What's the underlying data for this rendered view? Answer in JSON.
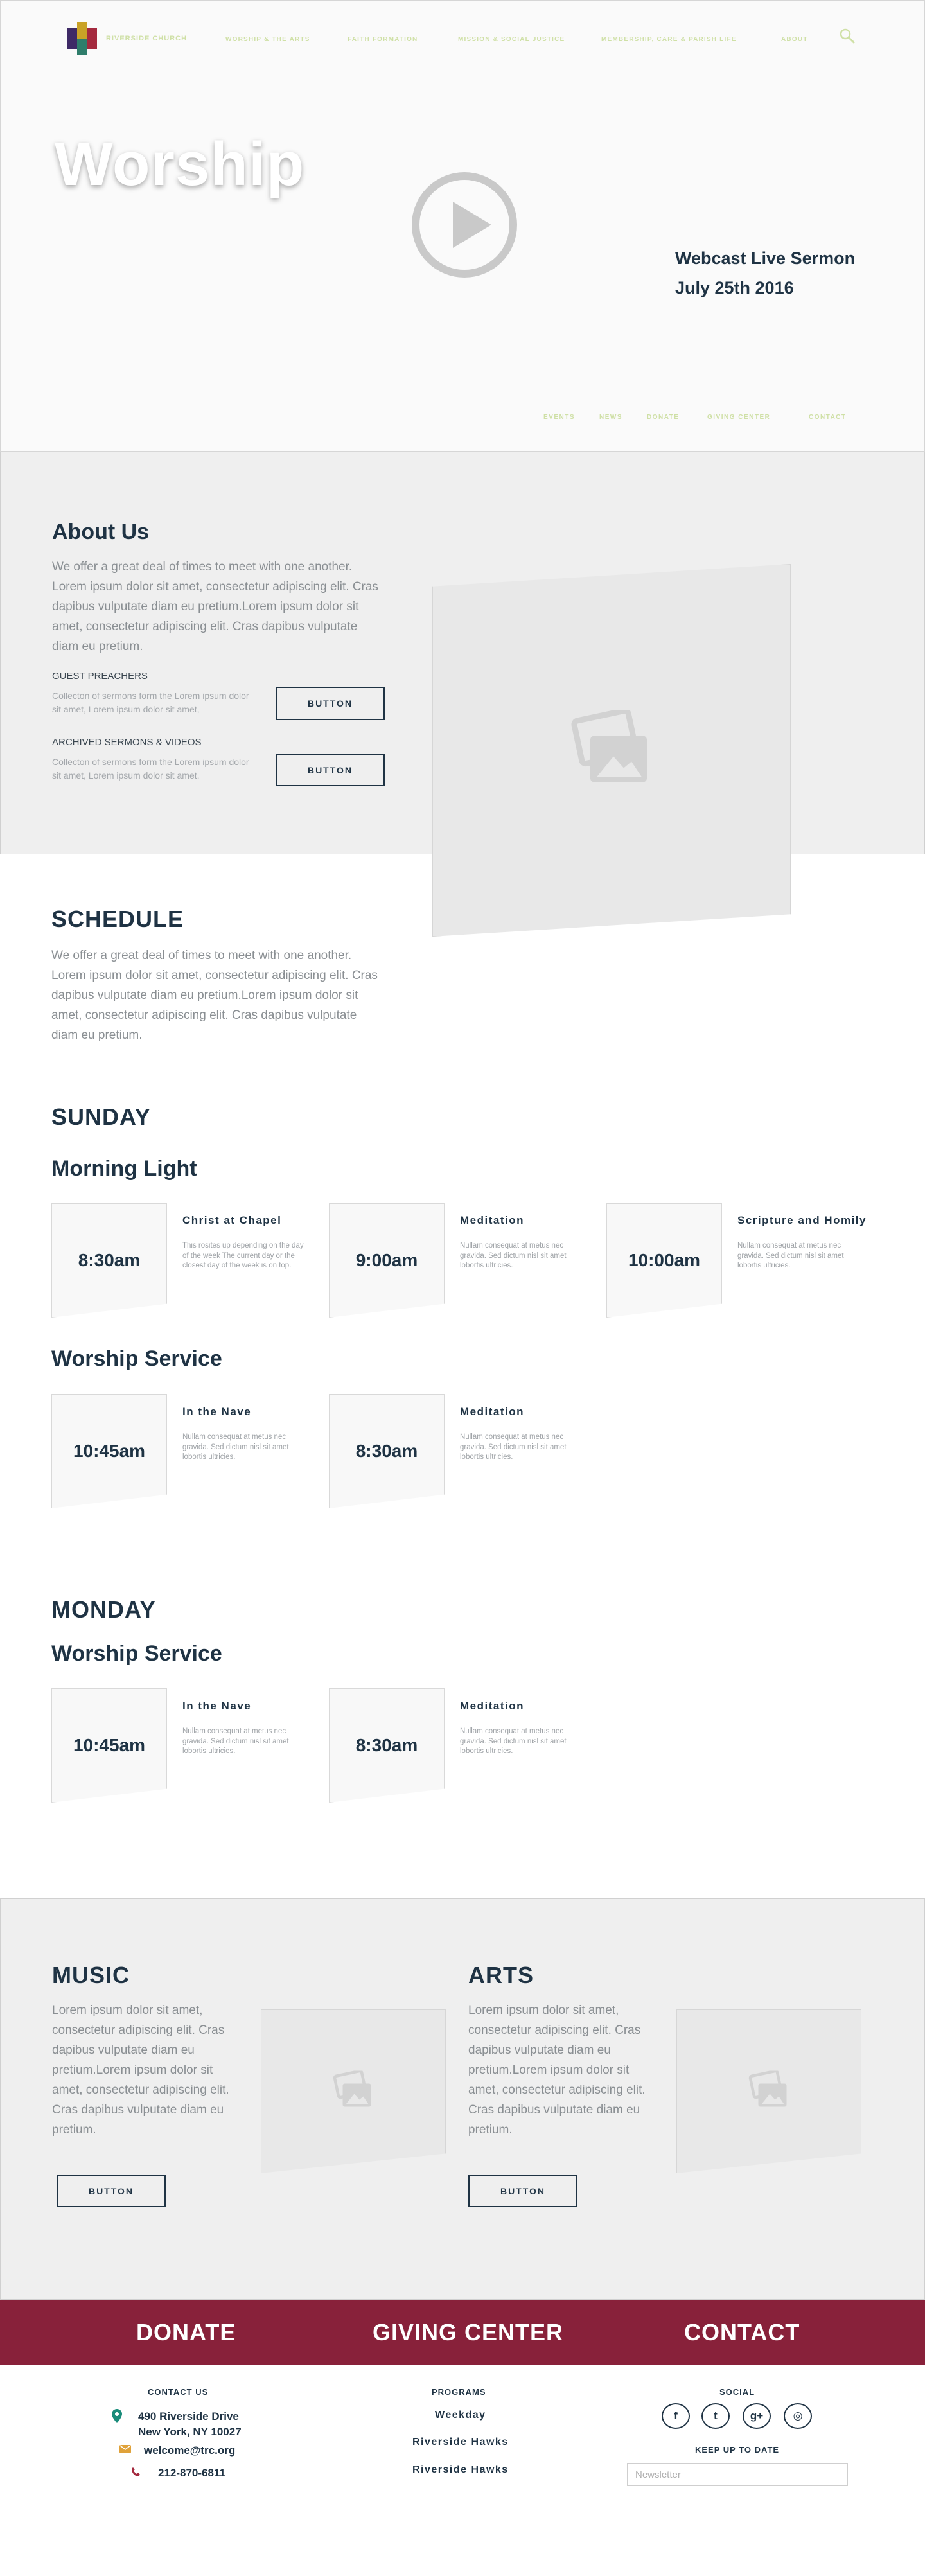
{
  "nav": {
    "logo_text": "RIVERSIDE CHURCH",
    "items": [
      "WORSHIP & THE ARTS",
      "FAITH FORMATION",
      "MISSION & SOCIAL JUSTICE",
      "MEMBERSHIP, CARE & PARISH LIFE",
      "ABOUT"
    ]
  },
  "hero": {
    "title": "Worship",
    "webcast_line1": "Webcast Live Sermon",
    "webcast_line2": "July 25th 2016"
  },
  "subnav": [
    "EVENTS",
    "NEWS",
    "DONATE",
    "GIVING CENTER",
    "CONTACT"
  ],
  "about": {
    "heading": "About Us",
    "body": "We offer a great deal of times to meet with one another. Lorem ipsum dolor sit amet, consectetur adipiscing elit. Cras dapibus vulputate diam eu pretium.Lorem ipsum dolor sit amet, consectetur adipiscing elit. Cras dapibus vulputate diam eu pretium.",
    "guest_label": "GUEST PREACHERS",
    "guest_text": "Collecton of sermons form the Lorem ipsum dolor sit amet,  Lorem ipsum dolor sit amet,",
    "archived_label": "ARCHIVED SERMONS & VIDEOS",
    "archived_text": "Collecton of sermons form the Lorem ipsum dolor sit amet,  Lorem ipsum dolor sit amet,",
    "button_label": "BUTTON"
  },
  "schedule": {
    "heading": "SCHEDULE",
    "body": "We offer a great deal of times to meet with one another. Lorem ipsum dolor sit amet, consectetur adipiscing elit. Cras dapibus vulputate diam eu pretium.Lorem ipsum dolor sit amet, consectetur adipiscing elit. Cras dapibus vulputate diam eu pretium.",
    "sunday": {
      "day": "SUNDAY",
      "morning_heading": "Morning Light",
      "morning": [
        {
          "time": "8:30am",
          "title": "Christ at Chapel",
          "desc": "This rosites up depending on the day of the week The current day or the closest day of the week is on top."
        },
        {
          "time": "9:00am",
          "title": "Meditation",
          "desc": "Nullam consequat at metus nec gravida. Sed dictum nisl sit amet lobortis ultricies."
        },
        {
          "time": "10:00am",
          "title": "Scripture and Homily",
          "desc": "Nullam consequat at metus nec gravida. Sed dictum nisl sit amet lobortis ultricies."
        }
      ],
      "service_heading": "Worship Service",
      "service": [
        {
          "time": "10:45am",
          "title": "In the Nave",
          "desc": "Nullam consequat at metus nec gravida. Sed dictum nisl sit amet lobortis ultricies."
        },
        {
          "time": "8:30am",
          "title": "Meditation",
          "desc": "Nullam consequat at metus nec gravida. Sed dictum nisl sit amet lobortis ultricies."
        }
      ]
    },
    "monday": {
      "day": "MONDAY",
      "service_heading": "Worship Service",
      "service": [
        {
          "time": "10:45am",
          "title": "In the Nave",
          "desc": "Nullam consequat at metus nec gravida. Sed dictum nisl sit amet lobortis ultricies."
        },
        {
          "time": "8:30am",
          "title": "Meditation",
          "desc": "Nullam consequat at metus nec gravida. Sed dictum nisl sit amet lobortis ultricies."
        }
      ]
    }
  },
  "arts": {
    "music_heading": "MUSIC",
    "music_body": "Lorem ipsum dolor sit amet, consectetur adipiscing elit. Cras dapibus vulputate diam eu pretium.Lorem ipsum dolor sit amet, consectetur adipiscing elit. Cras dapibus vulputate diam eu pretium.",
    "arts_heading": "ARTS",
    "arts_body": "Lorem ipsum dolor sit amet, consectetur adipiscing elit. Cras dapibus vulputate diam eu pretium.Lorem ipsum dolor sit amet, consectetur adipiscing elit. Cras dapibus vulputate diam eu pretium.",
    "button_label": "BUTTON"
  },
  "cta": {
    "donate": "DONATE",
    "giving": "GIVING CENTER",
    "contact": "CONTACT"
  },
  "footer": {
    "contact_heading": "CONTACT US",
    "address1": "490 Riverside Drive",
    "address2": "New York, NY 10027",
    "email": "welcome@trc.org",
    "phone": "212-870-6811",
    "programs_heading": "PROGRAMS",
    "programs": [
      "Weekday",
      "Riverside Hawks",
      "Riverside Hawks"
    ],
    "social_heading": "SOCIAL",
    "social": [
      {
        "icon": "facebook-icon",
        "glyph": "f"
      },
      {
        "icon": "twitter-icon",
        "glyph": "t"
      },
      {
        "icon": "google-plus-icon",
        "glyph": "g+"
      },
      {
        "icon": "instagram-icon",
        "glyph": "◎"
      }
    ],
    "keep_up": "KEEP UP TO DATE",
    "newsletter_placeholder": "Newsletter"
  },
  "colors": {
    "navy": "#1f3344",
    "burgundy": "#88213a",
    "nav_text": "#cfe0a6",
    "panel": "#efefef"
  }
}
